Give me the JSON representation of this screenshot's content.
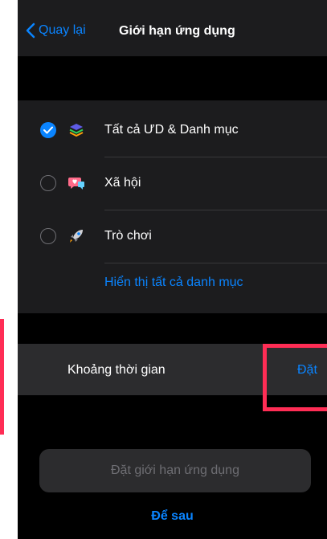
{
  "navbar": {
    "back_label": "Quay lại",
    "title": "Giới hạn ứng dụng"
  },
  "categories": [
    {
      "label": "Tất cả ƯD & Danh mục",
      "checked": true,
      "icon": "stack-icon"
    },
    {
      "label": "Xã hội",
      "checked": false,
      "icon": "chat-heart-icon"
    },
    {
      "label": "Trò chơi",
      "checked": false,
      "icon": "rocket-icon"
    }
  ],
  "show_all_link": "Hiển thị tất cả danh mục",
  "time_row": {
    "label": "Khoảng thời gian",
    "value": "Đặt"
  },
  "set_limit_button": "Đặt giới hạn ứng dụng",
  "later_button": "Để sau",
  "colors": {
    "accent": "#0a84ff",
    "highlight": "#ff2d55",
    "background": "#1c1c1e"
  }
}
